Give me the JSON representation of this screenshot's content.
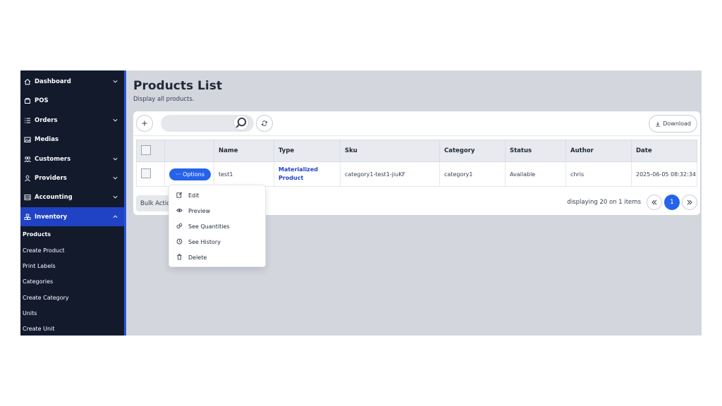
{
  "sidebar": {
    "items": [
      {
        "label": "Dashboard",
        "icon": "home-icon",
        "has_chevron": true
      },
      {
        "label": "POS",
        "icon": "pos-icon",
        "has_chevron": false
      },
      {
        "label": "Orders",
        "icon": "list-icon",
        "has_chevron": true
      },
      {
        "label": "Medias",
        "icon": "image-icon",
        "has_chevron": false
      },
      {
        "label": "Customers",
        "icon": "users-icon",
        "has_chevron": true
      },
      {
        "label": "Providers",
        "icon": "user-icon",
        "has_chevron": true
      },
      {
        "label": "Accounting",
        "icon": "accounting-icon",
        "has_chevron": true
      },
      {
        "label": "Inventory",
        "icon": "inventory-icon",
        "has_chevron": true,
        "active": true
      }
    ],
    "subitems": [
      "Products",
      "Create Product",
      "Print Labels",
      "Categories",
      "Create Category",
      "Units",
      "Create Unit"
    ],
    "current_subitem": "Products"
  },
  "page": {
    "title": "Products List",
    "subtitle": "Display all products."
  },
  "toolbar": {
    "search_value": "",
    "search_placeholder": "",
    "download_label": "Download"
  },
  "table": {
    "columns": [
      "Name",
      "Type",
      "Sku",
      "Category",
      "Status",
      "Author",
      "Date"
    ],
    "rows": [
      {
        "options_label": "··· Options",
        "name": "test1",
        "type_line1": "Materialized",
        "type_line2": "Product",
        "sku": "category1-test1-jiuKF",
        "category": "category1",
        "status": "Available",
        "author": "chris",
        "date": "2025-06-05 08:32:34"
      }
    ]
  },
  "footer": {
    "bulk_actions_label": "Bulk Actions",
    "paging_text": "displaying 20 on 1 items",
    "current_page": "1"
  },
  "options_menu": {
    "items": [
      {
        "label": "Edit",
        "icon": "edit-icon"
      },
      {
        "label": "Preview",
        "icon": "eye-icon"
      },
      {
        "label": "See Quantities",
        "icon": "quantities-icon"
      },
      {
        "label": "See History",
        "icon": "history-icon"
      },
      {
        "label": "Delete",
        "icon": "trash-icon"
      }
    ]
  },
  "colors": {
    "sidebar_bg": "#121a2c",
    "accent": "#2563eb",
    "active_nav": "#1f43c4",
    "content_bg": "#d4d6de"
  }
}
